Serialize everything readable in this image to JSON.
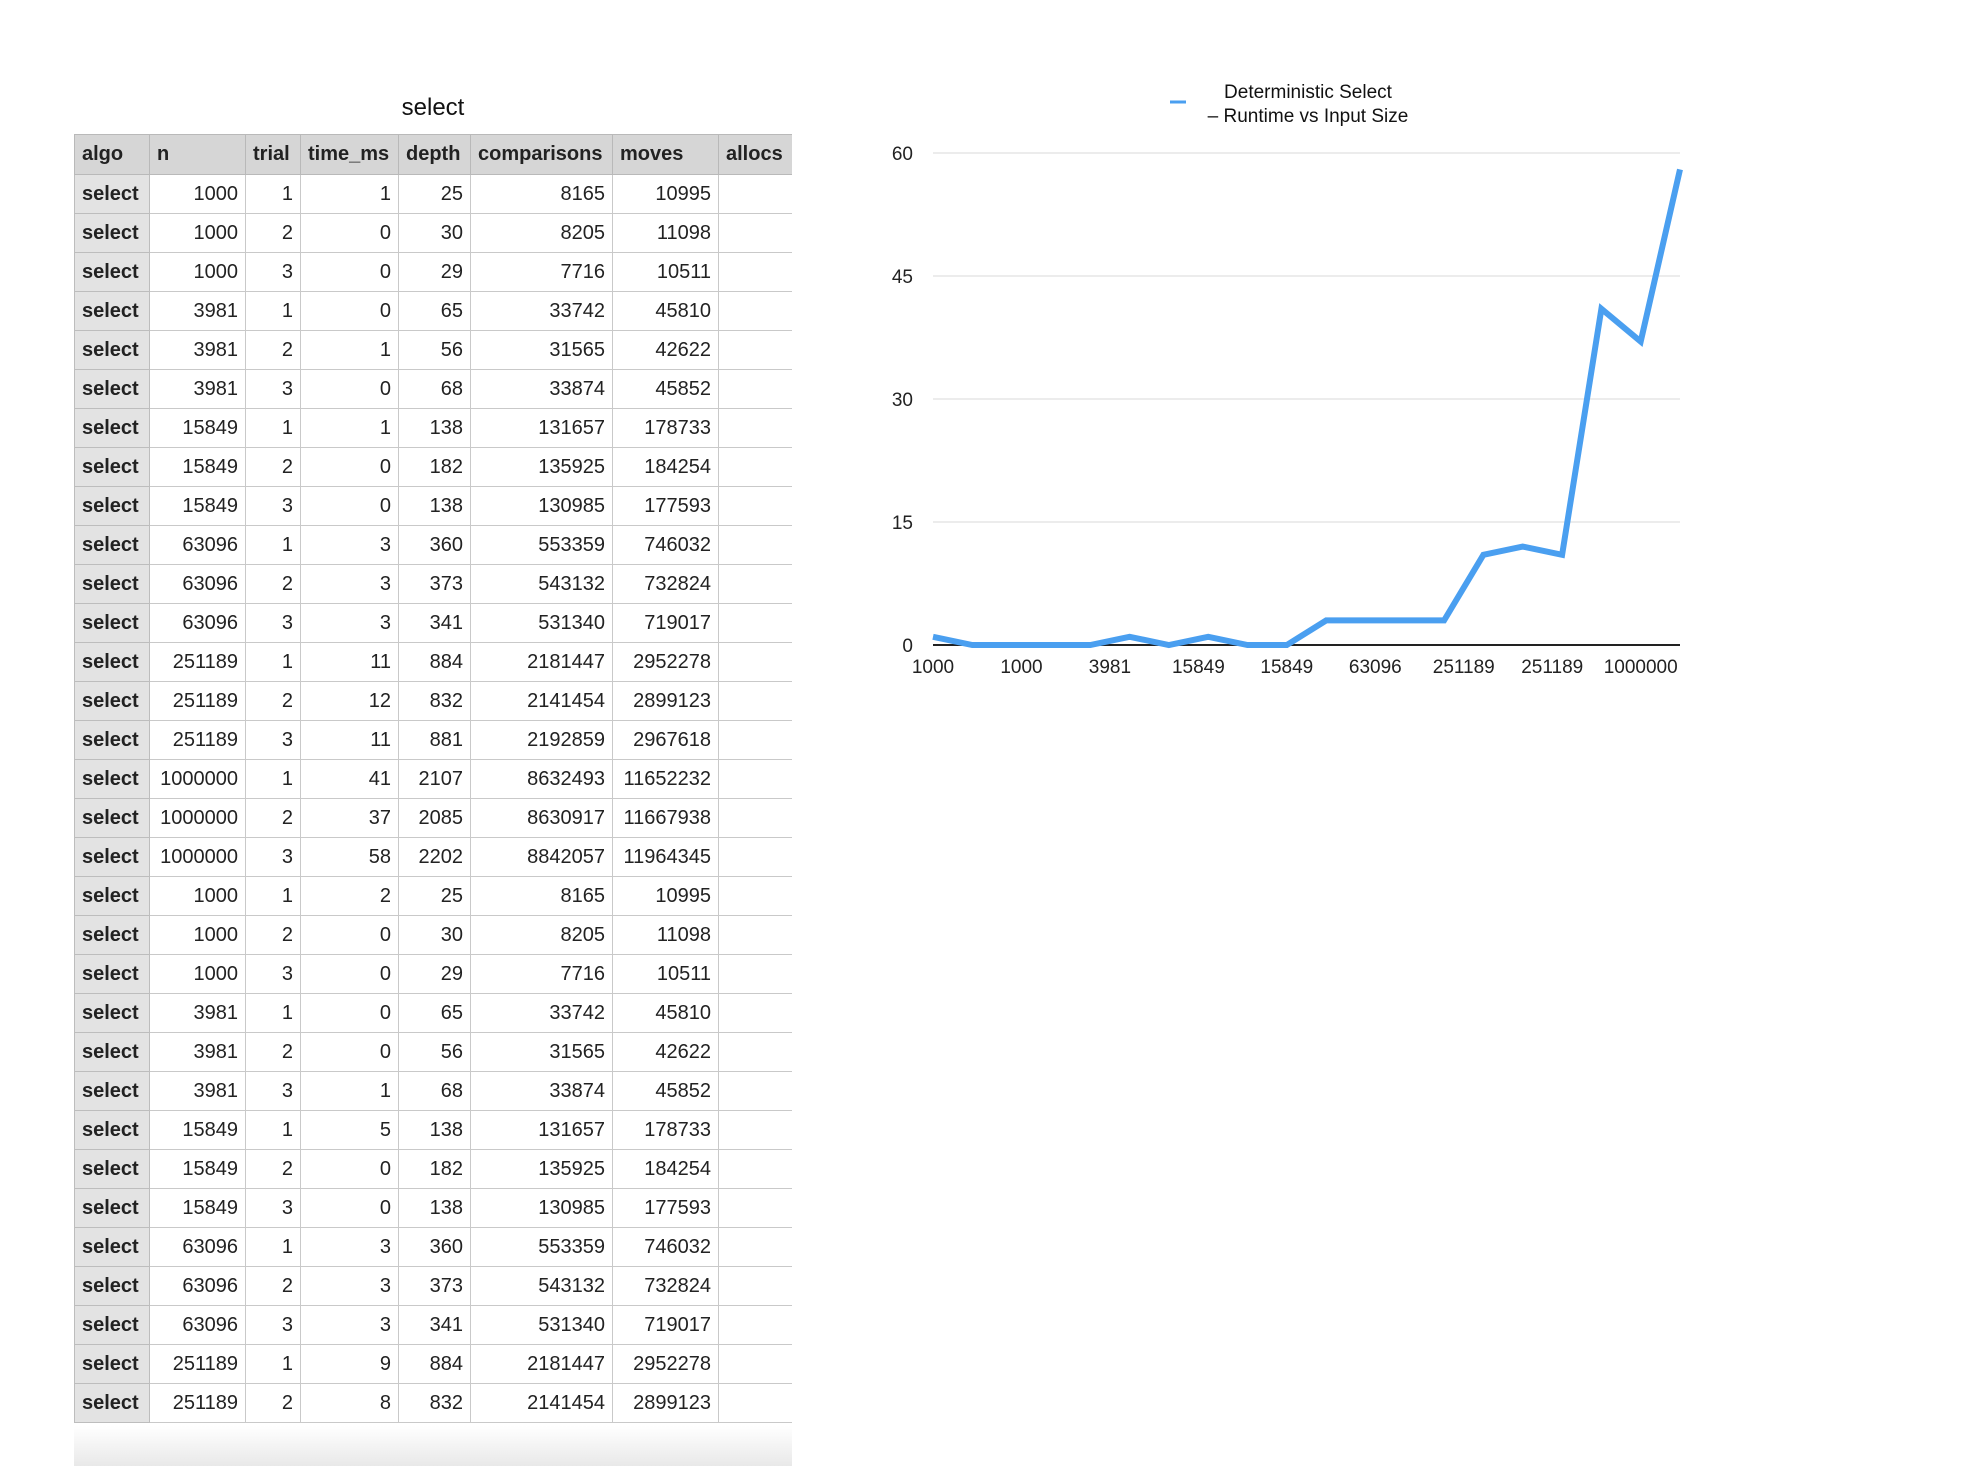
{
  "sheet": {
    "title": "select",
    "columns": [
      "algo",
      "n",
      "trial",
      "time_ms",
      "depth",
      "comparisons",
      "moves",
      "allocs"
    ],
    "rows": [
      [
        "select",
        "1000",
        "1",
        "1",
        "25",
        "8165",
        "10995",
        ""
      ],
      [
        "select",
        "1000",
        "2",
        "0",
        "30",
        "8205",
        "11098",
        ""
      ],
      [
        "select",
        "1000",
        "3",
        "0",
        "29",
        "7716",
        "10511",
        ""
      ],
      [
        "select",
        "3981",
        "1",
        "0",
        "65",
        "33742",
        "45810",
        ""
      ],
      [
        "select",
        "3981",
        "2",
        "1",
        "56",
        "31565",
        "42622",
        ""
      ],
      [
        "select",
        "3981",
        "3",
        "0",
        "68",
        "33874",
        "45852",
        ""
      ],
      [
        "select",
        "15849",
        "1",
        "1",
        "138",
        "131657",
        "178733",
        ""
      ],
      [
        "select",
        "15849",
        "2",
        "0",
        "182",
        "135925",
        "184254",
        ""
      ],
      [
        "select",
        "15849",
        "3",
        "0",
        "138",
        "130985",
        "177593",
        ""
      ],
      [
        "select",
        "63096",
        "1",
        "3",
        "360",
        "553359",
        "746032",
        ""
      ],
      [
        "select",
        "63096",
        "2",
        "3",
        "373",
        "543132",
        "732824",
        ""
      ],
      [
        "select",
        "63096",
        "3",
        "3",
        "341",
        "531340",
        "719017",
        ""
      ],
      [
        "select",
        "251189",
        "1",
        "11",
        "884",
        "2181447",
        "2952278",
        ""
      ],
      [
        "select",
        "251189",
        "2",
        "12",
        "832",
        "2141454",
        "2899123",
        ""
      ],
      [
        "select",
        "251189",
        "3",
        "11",
        "881",
        "2192859",
        "2967618",
        ""
      ],
      [
        "select",
        "1000000",
        "1",
        "41",
        "2107",
        "8632493",
        "11652232",
        ""
      ],
      [
        "select",
        "1000000",
        "2",
        "37",
        "2085",
        "8630917",
        "11667938",
        ""
      ],
      [
        "select",
        "1000000",
        "3",
        "58",
        "2202",
        "8842057",
        "11964345",
        ""
      ],
      [
        "select",
        "1000",
        "1",
        "2",
        "25",
        "8165",
        "10995",
        ""
      ],
      [
        "select",
        "1000",
        "2",
        "0",
        "30",
        "8205",
        "11098",
        ""
      ],
      [
        "select",
        "1000",
        "3",
        "0",
        "29",
        "7716",
        "10511",
        ""
      ],
      [
        "select",
        "3981",
        "1",
        "0",
        "65",
        "33742",
        "45810",
        ""
      ],
      [
        "select",
        "3981",
        "2",
        "0",
        "56",
        "31565",
        "42622",
        ""
      ],
      [
        "select",
        "3981",
        "3",
        "1",
        "68",
        "33874",
        "45852",
        ""
      ],
      [
        "select",
        "15849",
        "1",
        "5",
        "138",
        "131657",
        "178733",
        ""
      ],
      [
        "select",
        "15849",
        "2",
        "0",
        "182",
        "135925",
        "184254",
        ""
      ],
      [
        "select",
        "15849",
        "3",
        "0",
        "138",
        "130985",
        "177593",
        ""
      ],
      [
        "select",
        "63096",
        "1",
        "3",
        "360",
        "553359",
        "746032",
        ""
      ],
      [
        "select",
        "63096",
        "2",
        "3",
        "373",
        "543132",
        "732824",
        ""
      ],
      [
        "select",
        "63096",
        "3",
        "3",
        "341",
        "531340",
        "719017",
        ""
      ],
      [
        "select",
        "251189",
        "1",
        "9",
        "884",
        "2181447",
        "2952278",
        ""
      ],
      [
        "select",
        "251189",
        "2",
        "8",
        "832",
        "2141454",
        "2899123",
        ""
      ]
    ]
  },
  "chart_data": {
    "type": "line",
    "title": "",
    "series": [
      {
        "name": "Deterministic Select\n– Runtime vs Input Size",
        "color": "#4a9ff0",
        "values": [
          1,
          0,
          0,
          0,
          0,
          1,
          0,
          1,
          0,
          0,
          3,
          3,
          3,
          3,
          11,
          12,
          11,
          41,
          37,
          58
        ]
      }
    ],
    "x": [
      "1000",
      "1000",
      "1000",
      "3981",
      "3981",
      "3981",
      "15849",
      "15849",
      "15849",
      "63096",
      "63096",
      "63096",
      "251189",
      "251189",
      "251189",
      "1000000",
      "1000000",
      "1000000",
      "1000",
      "1000"
    ],
    "x_tick_labels": [
      "1000",
      "1000",
      "3981",
      "15849",
      "15849",
      "63096",
      "251189",
      "251189",
      "1000000"
    ],
    "y_ticks": [
      0,
      15,
      30,
      45,
      60
    ],
    "ylim": [
      0,
      60
    ],
    "legend": "top",
    "grid": true
  }
}
